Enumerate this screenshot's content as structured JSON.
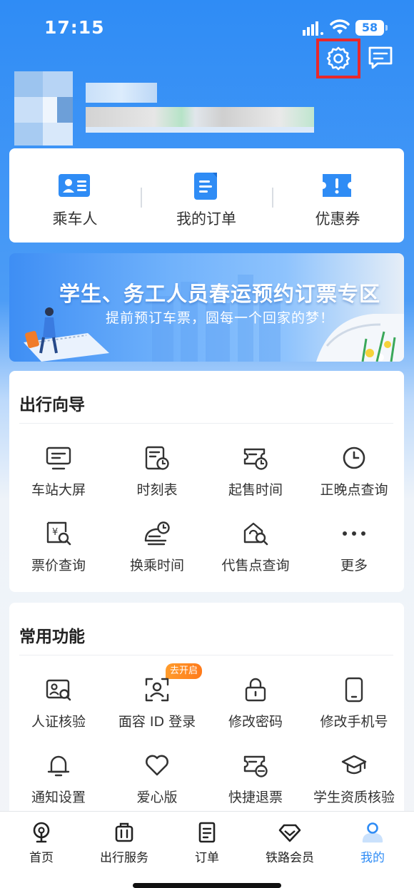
{
  "status_bar": {
    "time": "17:15",
    "battery": "58"
  },
  "profile": {},
  "quick_actions": [
    {
      "label": "乘车人",
      "icon": "passenger-card-icon"
    },
    {
      "label": "我的订单",
      "icon": "order-doc-icon"
    },
    {
      "label": "优惠券",
      "icon": "coupon-icon"
    }
  ],
  "banner": {
    "title": "学生、务工人员春运预约订票专区",
    "subtitle": "提前预订车票，圆每一个回家的梦！"
  },
  "travel_guide": {
    "title": "出行向导",
    "items": [
      {
        "label": "车站大屏",
        "icon": "station-screen-icon"
      },
      {
        "label": "时刻表",
        "icon": "timetable-icon"
      },
      {
        "label": "起售时间",
        "icon": "sale-time-icon"
      },
      {
        "label": "正晚点查询",
        "icon": "clock-icon"
      },
      {
        "label": "票价查询",
        "icon": "fare-search-icon"
      },
      {
        "label": "换乘时间",
        "icon": "transfer-time-icon"
      },
      {
        "label": "代售点查询",
        "icon": "agency-search-icon"
      },
      {
        "label": "更多",
        "icon": "more-icon"
      }
    ]
  },
  "common_functions": {
    "title": "常用功能",
    "badge": "去开启",
    "items": [
      {
        "label": "人证核验",
        "icon": "id-verify-icon"
      },
      {
        "label": "面容 ID 登录",
        "icon": "face-id-icon"
      },
      {
        "label": "修改密码",
        "icon": "lock-icon"
      },
      {
        "label": "修改手机号",
        "icon": "phone-icon"
      },
      {
        "label": "通知设置",
        "icon": "bell-icon"
      },
      {
        "label": "爱心版",
        "icon": "heart-icon"
      },
      {
        "label": "快捷退票",
        "icon": "refund-ticket-icon"
      },
      {
        "label": "学生资质核验",
        "icon": "graduation-cap-icon"
      }
    ]
  },
  "tab_bar": [
    {
      "label": "首页",
      "icon": "home-train-icon"
    },
    {
      "label": "出行服务",
      "icon": "luggage-icon"
    },
    {
      "label": "订单",
      "icon": "order-icon"
    },
    {
      "label": "铁路会员",
      "icon": "diamond-icon"
    },
    {
      "label": "我的",
      "icon": "person-icon",
      "active": true
    }
  ],
  "colors": {
    "primary": "#2f8cf5",
    "highlight": "#e8282b",
    "badge": "#ff8a22"
  }
}
